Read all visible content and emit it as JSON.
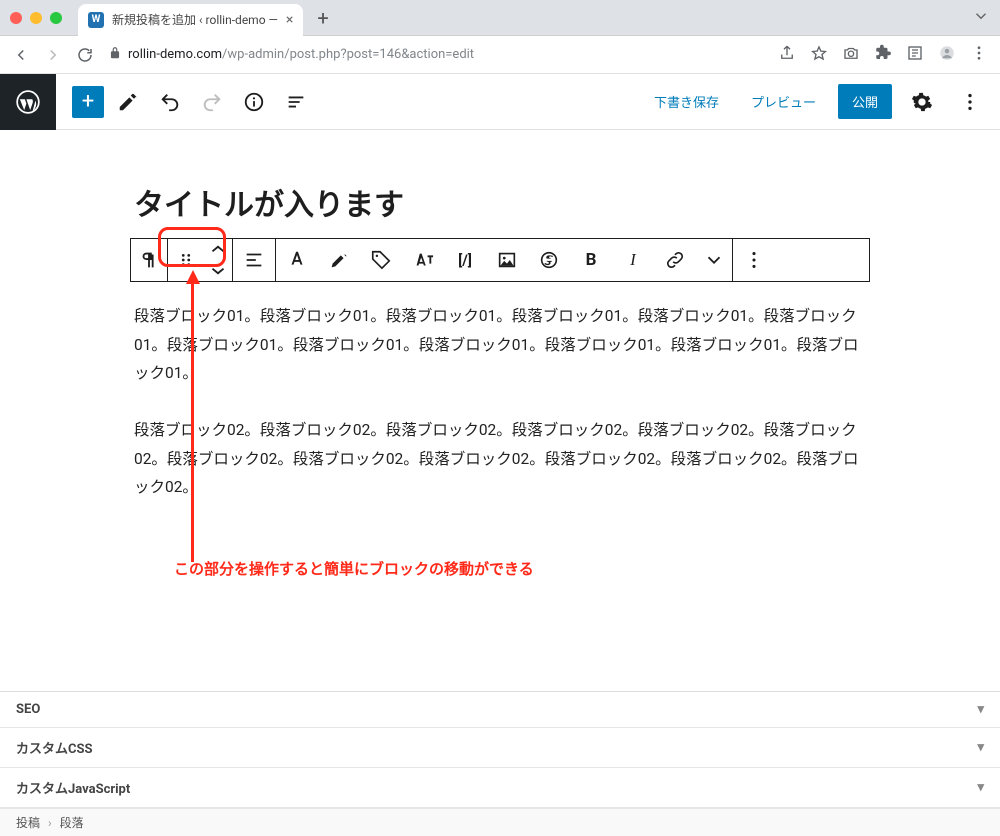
{
  "browser": {
    "tab_title": "新規投稿を追加 ‹ rollin-demo —",
    "url_host": "rollin-demo.com",
    "url_path": "/wp-admin/post.php?post=146&action=edit"
  },
  "editor_top": {
    "save_draft": "下書き保存",
    "preview": "プレビュー",
    "publish": "公開"
  },
  "post": {
    "title": "タイトルが入ります",
    "paragraph1": "段落ブロック01。段落ブロック01。段落ブロック01。段落ブロック01。段落ブロック01。段落ブロック01。段落ブロック01。段落ブロック01。段落ブロック01。段落ブロック01。段落ブロック01。段落ブロック01。",
    "paragraph2": "段落ブロック02。段落ブロック02。段落ブロック02。段落ブロック02。段落ブロック02。段落ブロック02。段落ブロック02。段落ブロック02。段落ブロック02。段落ブロック02。段落ブロック02。段落ブロック02。"
  },
  "annotation": {
    "text": "この部分を操作すると簡単にブロックの移動ができる"
  },
  "metaboxes": {
    "seo": "SEO",
    "custom_css": "カスタムCSS",
    "custom_js": "カスタムJavaScript"
  },
  "breadcrumb": {
    "root": "投稿",
    "current": "段落"
  }
}
